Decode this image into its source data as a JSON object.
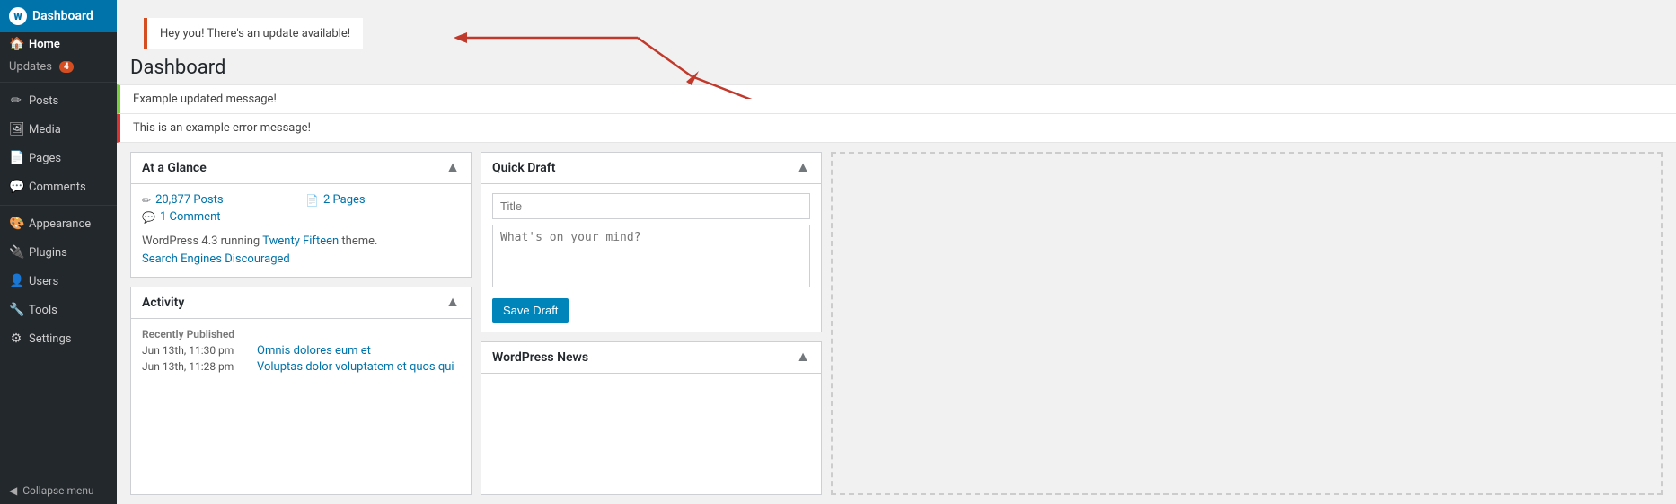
{
  "sidebar": {
    "header_label": "Dashboard",
    "wp_icon": "wordpress-icon",
    "items": [
      {
        "id": "home",
        "label": "Home",
        "icon": "🏠",
        "active": true,
        "type": "home"
      },
      {
        "id": "updates",
        "label": "Updates",
        "icon": "🔄",
        "badge": "4",
        "type": "sub"
      },
      {
        "id": "posts",
        "label": "Posts",
        "icon": "📝"
      },
      {
        "id": "media",
        "label": "Media",
        "icon": "🖼"
      },
      {
        "id": "pages",
        "label": "Pages",
        "icon": "📄"
      },
      {
        "id": "comments",
        "label": "Comments",
        "icon": "💬"
      },
      {
        "id": "appearance",
        "label": "Appearance",
        "icon": "🎨"
      },
      {
        "id": "plugins",
        "label": "Plugins",
        "icon": "🔌"
      },
      {
        "id": "users",
        "label": "Users",
        "icon": "👤"
      },
      {
        "id": "tools",
        "label": "Tools",
        "icon": "🔧"
      },
      {
        "id": "settings",
        "label": "Settings",
        "icon": "⚙"
      }
    ],
    "collapse_label": "Collapse menu"
  },
  "update_bar": {
    "message": "Hey you! There's an update available!"
  },
  "page_title": "Dashboard",
  "notices": {
    "updated": "Example updated message!",
    "error": "This is an example error message!"
  },
  "at_a_glance": {
    "title": "At a Glance",
    "posts_count": "20,877",
    "posts_label": "Posts",
    "pages_count": "2",
    "pages_label": "Pages",
    "comments_count": "1",
    "comments_label": "Comment",
    "wp_version": "WordPress 4.3 running",
    "theme_name": "Twenty Fifteen",
    "theme_suffix": "theme.",
    "search_engines": "Search Engines Discouraged"
  },
  "quick_draft": {
    "title": "Quick Draft",
    "title_placeholder": "Title",
    "body_placeholder": "What's on your mind?",
    "save_label": "Save Draft"
  },
  "activity": {
    "title": "Activity",
    "section_title": "Recently Published",
    "items": [
      {
        "date": "Jun 13th, 11:30 pm",
        "label": "Omnis dolores eum et"
      },
      {
        "date": "Jun 13th, 11:28 pm",
        "label": "Voluptas dolor voluptatem et quos qui"
      }
    ]
  },
  "wp_news": {
    "title": "WordPress News"
  }
}
